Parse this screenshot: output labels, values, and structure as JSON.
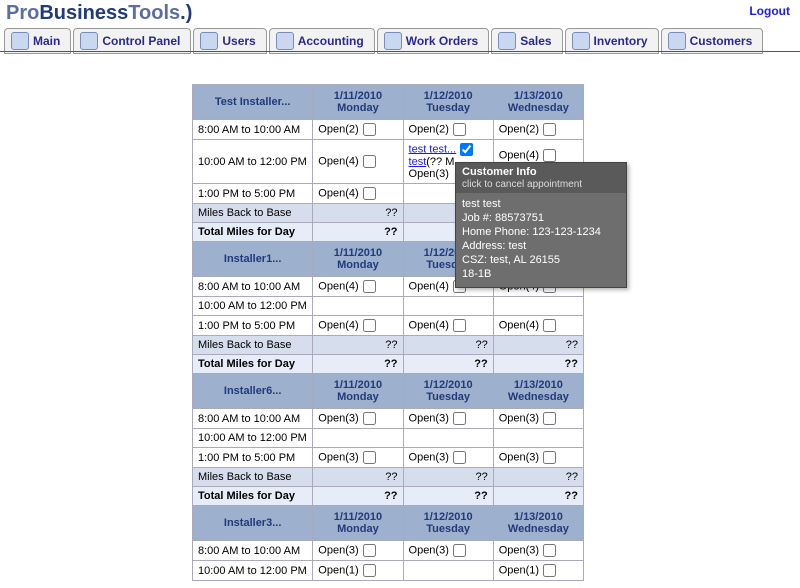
{
  "app": {
    "logo_pro": "Pro",
    "logo_business": "Business",
    "logo_tools": "Tools",
    "logo_tail": ".)"
  },
  "logout_label": "Logout",
  "nav": [
    {
      "label": "Main",
      "icon": "globe-icon"
    },
    {
      "label": "Control Panel",
      "icon": "wand-icon"
    },
    {
      "label": "Users",
      "icon": "users-icon"
    },
    {
      "label": "Accounting",
      "icon": "accounting-icon"
    },
    {
      "label": "Work Orders",
      "icon": "workorders-icon"
    },
    {
      "label": "Sales",
      "icon": "sales-icon"
    },
    {
      "label": "Inventory",
      "icon": "inventory-icon"
    },
    {
      "label": "Customers",
      "icon": "customers-icon"
    }
  ],
  "dates": [
    {
      "date": "1/11/2010",
      "dow": "Monday"
    },
    {
      "date": "1/12/2010",
      "dow": "Tuesday"
    },
    {
      "date": "1/13/2010",
      "dow": "Wednesday"
    }
  ],
  "rows_labels": {
    "miles_back": "Miles Back to Base",
    "total_miles": "Total Miles for Day",
    "unknown": "??"
  },
  "tooltip": {
    "title": "Customer Info",
    "subtitle": "click to cancel appointment",
    "name": "test test",
    "job": "Job #: 88573751",
    "home_phone": "Home Phone: 123-123-1234",
    "address": "Address: test",
    "csz": "CSZ: test, AL 26155",
    "code": "18-1B"
  },
  "groups": [
    {
      "installer": "Test Installer...",
      "rows": [
        {
          "time": "8:00 AM to 10:00 AM",
          "cells": [
            {
              "t": "Open(2)",
              "cb": true
            },
            {
              "t": "Open(2)",
              "cb": true
            },
            {
              "t": "Open(2)",
              "cb": true
            }
          ]
        },
        {
          "time": "10:00 AM to 12:00 PM",
          "cells": [
            {
              "t": "Open(4)",
              "cb": true
            },
            {
              "links": [
                "test test...",
                "test"
              ],
              "trail": "(?? M",
              "extra": "Open(3)",
              "checked": true,
              "cb": true
            },
            {
              "t": "Open(4)",
              "cb": true,
              "extra": "Open(4)"
            }
          ]
        },
        {
          "time": "1:00 PM to 5:00 PM",
          "cells": [
            {
              "t": "Open(4)",
              "cb": true
            },
            {
              "t": ""
            },
            {
              "t": ""
            }
          ]
        }
      ],
      "miles": [
        "??",
        "",
        ""
      ],
      "total": [
        "??",
        "",
        ""
      ]
    },
    {
      "installer": "Installer1...",
      "rows": [
        {
          "time": "8:00 AM to 10:00 AM",
          "cells": [
            {
              "t": "Open(4)",
              "cb": true
            },
            {
              "t": "Open(4)",
              "cb": true
            },
            {
              "t": "Open(4)",
              "cb": true
            }
          ]
        },
        {
          "time": "10:00 AM to 12:00 PM",
          "cells": [
            {
              "t": ""
            },
            {
              "t": ""
            },
            {
              "t": ""
            }
          ]
        },
        {
          "time": "1:00 PM to 5:00 PM",
          "cells": [
            {
              "t": "Open(4)",
              "cb": true
            },
            {
              "t": "Open(4)",
              "cb": true
            },
            {
              "t": "Open(4)",
              "cb": true
            }
          ]
        }
      ],
      "miles": [
        "??",
        "??",
        "??"
      ],
      "total": [
        "??",
        "??",
        "??"
      ]
    },
    {
      "installer": "Installer6...",
      "rows": [
        {
          "time": "8:00 AM to 10:00 AM",
          "cells": [
            {
              "t": "Open(3)",
              "cb": true
            },
            {
              "t": "Open(3)",
              "cb": true
            },
            {
              "t": "Open(3)",
              "cb": true
            }
          ]
        },
        {
          "time": "10:00 AM to 12:00 PM",
          "cells": [
            {
              "t": ""
            },
            {
              "t": ""
            },
            {
              "t": ""
            }
          ]
        },
        {
          "time": "1:00 PM to 5:00 PM",
          "cells": [
            {
              "t": "Open(3)",
              "cb": true
            },
            {
              "t": "Open(3)",
              "cb": true
            },
            {
              "t": "Open(3)",
              "cb": true
            }
          ]
        }
      ],
      "miles": [
        "??",
        "??",
        "??"
      ],
      "total": [
        "??",
        "??",
        "??"
      ]
    },
    {
      "installer": "Installer3...",
      "rows": [
        {
          "time": "8:00 AM to 10:00 AM",
          "cells": [
            {
              "t": "Open(3)",
              "cb": true
            },
            {
              "t": "Open(3)",
              "cb": true
            },
            {
              "t": "Open(3)",
              "cb": true
            }
          ]
        },
        {
          "time": "10:00 AM to 12:00 PM",
          "cells": [
            {
              "t": "Open(1)",
              "cb": true
            },
            {
              "t": ""
            },
            {
              "t": "Open(1)",
              "cb": true
            }
          ]
        }
      ],
      "miles": null,
      "total": null
    }
  ]
}
